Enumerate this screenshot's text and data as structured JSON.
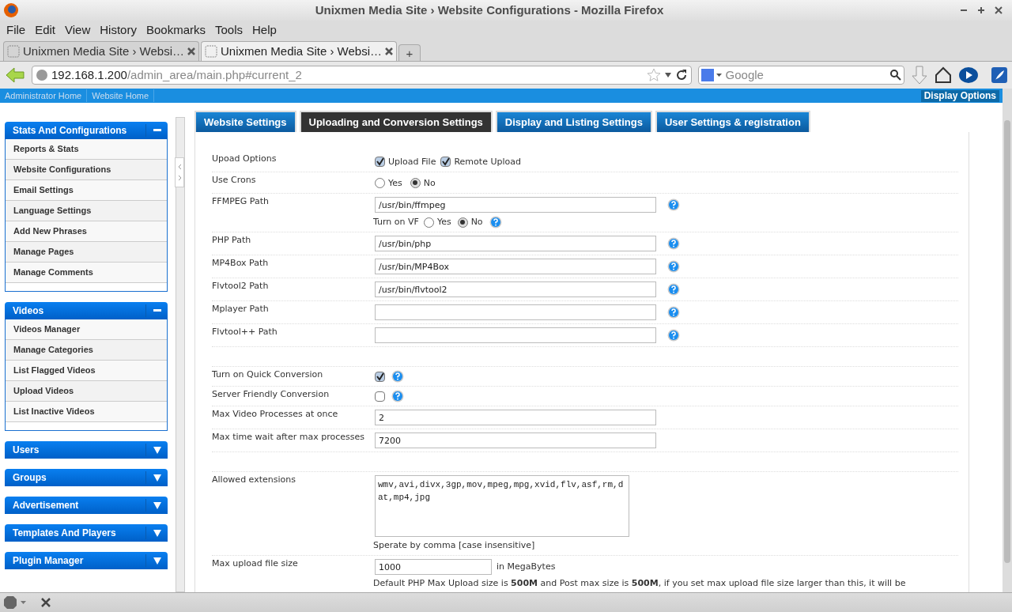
{
  "window": {
    "title": "Unixmen Media Site › Website Configurations - Mozilla Firefox"
  },
  "menu": [
    "File",
    "Edit",
    "View",
    "History",
    "Bookmarks",
    "Tools",
    "Help"
  ],
  "browser_tabs": [
    {
      "label": "Unixmen Media Site › Websi…",
      "selected": false
    },
    {
      "label": "Unixmen Media Site › Websi…",
      "selected": true
    }
  ],
  "new_tab": "+",
  "address": {
    "host": "192.168.1.200",
    "path": "/admin_area/main.php#current_2"
  },
  "search": {
    "placeholder": "Google"
  },
  "site_nav": [
    "Administrator Home",
    "Website Home"
  ],
  "display_options": "Display Options",
  "sidebar": {
    "panels": [
      {
        "title": "Stats And Configurations",
        "expanded": true,
        "items": [
          "Reports & Stats",
          "Website Configurations",
          "Email Settings",
          "Language Settings",
          "Add New Phrases",
          "Manage Pages",
          "Manage Comments"
        ]
      },
      {
        "title": "Videos",
        "expanded": true,
        "items": [
          "Videos Manager",
          "Manage Categories",
          "List Flagged Videos",
          "Upload Videos",
          "List Inactive Videos"
        ]
      },
      {
        "title": "Users",
        "expanded": false
      },
      {
        "title": "Groups",
        "expanded": false
      },
      {
        "title": "Advertisement",
        "expanded": false
      },
      {
        "title": "Templates And Players",
        "expanded": false
      },
      {
        "title": "Plugin Manager",
        "expanded": false
      }
    ]
  },
  "settings_tabs": [
    {
      "label": "Website Settings",
      "selected": false
    },
    {
      "label": "Uploading and Conversion Settings",
      "selected": true
    },
    {
      "label": "Display and Listing Settings",
      "selected": false
    },
    {
      "label": "User Settings & registration",
      "selected": false
    }
  ],
  "form": {
    "rows": [
      {
        "kind": "checks",
        "label": "Upoad Options",
        "options": [
          {
            "label": "Upload File",
            "checked": true
          },
          {
            "label": "Remote Upload",
            "checked": true
          }
        ]
      },
      {
        "kind": "radios",
        "label": "Use Crons",
        "options": [
          {
            "label": "Yes",
            "selected": false
          },
          {
            "label": "No",
            "selected": true
          }
        ]
      },
      {
        "kind": "path",
        "label": "FFMPEG Path",
        "value": "/usr/bin/ffmpeg",
        "help": true,
        "sub": {
          "label": "Turn on VF",
          "options": [
            {
              "label": "Yes",
              "selected": false
            },
            {
              "label": "No",
              "selected": true
            }
          ]
        }
      },
      {
        "kind": "path",
        "label": "PHP Path",
        "value": "/usr/bin/php",
        "help": true
      },
      {
        "kind": "path",
        "label": "MP4Box Path",
        "value": "/usr/bin/MP4Box",
        "help": true
      },
      {
        "kind": "path",
        "label": "Flvtool2 Path",
        "value": "/usr/bin/flvtool2",
        "help": true
      },
      {
        "kind": "path",
        "label": "Mplayer Path",
        "help": true
      },
      {
        "kind": "path",
        "label": "Flvtool++ Path",
        "help": true
      },
      {
        "kind": "spacer"
      },
      {
        "kind": "check",
        "label": "Turn on Quick Conversion",
        "checked": true,
        "help": true
      },
      {
        "kind": "check",
        "label": "Server Friendly Conversion",
        "checked": false,
        "help": true
      },
      {
        "kind": "path",
        "label": "Max Video Processes at once",
        "value": "2"
      },
      {
        "kind": "path",
        "label": "Max time wait after max processes",
        "value": "7200"
      },
      {
        "kind": "spacer"
      },
      {
        "kind": "textarea",
        "label": "Allowed extensions",
        "value": "wmv,avi,divx,3gp,mov,mpeg,mpg,xvid,flv,asf,rm,dat,mp4,jpg",
        "note": "Sperate by comma [case insensitive]"
      },
      {
        "kind": "size",
        "label": "Max upload file size",
        "value": "1000",
        "unit": "in MegaBytes",
        "note": "Default PHP Max Upload size is **500M** and Post max size is **500M**, if you set max upload file size larger than this, it will be"
      }
    ]
  }
}
